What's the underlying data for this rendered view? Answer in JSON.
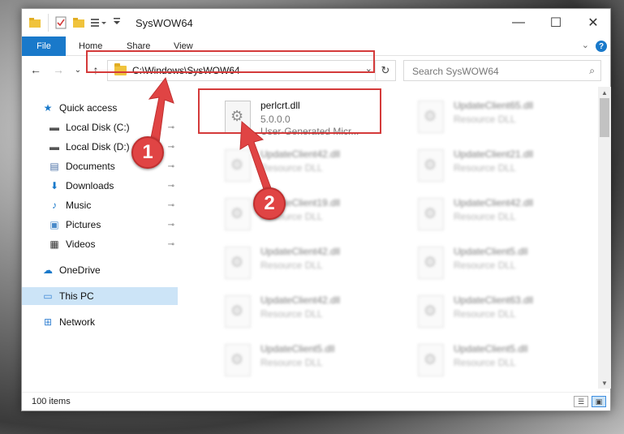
{
  "window": {
    "title": "SysWOW64",
    "minimize": "—",
    "maximize": "☐",
    "close": "✕"
  },
  "ribbon": {
    "tabs": [
      "File",
      "Home",
      "Share",
      "View"
    ],
    "help": "?",
    "collapse": "⌄"
  },
  "nav": {
    "back": "←",
    "forward": "→",
    "recent": "⌄",
    "up": "↑",
    "address": "C:\\Windows\\SysWOW64",
    "address_dropdown": "⌄",
    "refresh": "↻",
    "search_placeholder": "Search SysWOW64",
    "search_icon": "⌕"
  },
  "sidebar": {
    "items": [
      {
        "label": "Quick access",
        "icon": "star-icon",
        "glyph": "★",
        "color": "#1979ca"
      },
      {
        "label": "Local Disk (C:)",
        "icon": "drive-icon",
        "glyph": "▬",
        "color": "#555555",
        "pinned": true
      },
      {
        "label": "Local Disk (D:)",
        "icon": "drive-icon",
        "glyph": "▬",
        "color": "#555555",
        "pinned": true
      },
      {
        "label": "Documents",
        "icon": "documents-icon",
        "glyph": "▤",
        "color": "#4a6fa5",
        "pinned": true
      },
      {
        "label": "Downloads",
        "icon": "download-icon",
        "glyph": "⬇",
        "color": "#1979ca",
        "pinned": true
      },
      {
        "label": "Music",
        "icon": "music-icon",
        "glyph": "♪",
        "color": "#1979ca",
        "pinned": true
      },
      {
        "label": "Pictures",
        "icon": "pictures-icon",
        "glyph": "▣",
        "color": "#4a8ac9",
        "pinned": true
      },
      {
        "label": "Videos",
        "icon": "videos-icon",
        "glyph": "▦",
        "color": "#333333",
        "pinned": true
      },
      {
        "label": "OneDrive",
        "icon": "cloud-icon",
        "glyph": "☁",
        "color": "#1979ca"
      },
      {
        "label": "This PC",
        "icon": "computer-icon",
        "glyph": "▭",
        "color": "#3b86d4",
        "selected": true
      },
      {
        "label": "Network",
        "icon": "network-icon",
        "glyph": "⊞",
        "color": "#3b86d4"
      }
    ],
    "pin_glyph": "📌"
  },
  "files": [
    {
      "name": "perlcrt.dll",
      "meta1": "5.0.0.0",
      "meta2": "User-Generated Micr...",
      "highlighted": true
    },
    {
      "name": "UpdateClient65.dll",
      "meta1": "Resource DLL",
      "meta2": ""
    },
    {
      "name": "UpdateClient42.dll",
      "meta1": "Resource DLL",
      "meta2": ""
    },
    {
      "name": "UpdateClient21.dll",
      "meta1": "Resource DLL",
      "meta2": ""
    },
    {
      "name": "UpdateClient19.dll",
      "meta1": "Resource DLL",
      "meta2": ""
    },
    {
      "name": "UpdateClient42.dll",
      "meta1": "Resource DLL",
      "meta2": ""
    },
    {
      "name": "UpdateClient42.dll",
      "meta1": "Resource DLL",
      "meta2": ""
    },
    {
      "name": "UpdateClient5.dll",
      "meta1": "Resource DLL",
      "meta2": ""
    },
    {
      "name": "UpdateClient42.dll",
      "meta1": "Resource DLL",
      "meta2": ""
    },
    {
      "name": "UpdateClient63.dll",
      "meta1": "Resource DLL",
      "meta2": ""
    },
    {
      "name": "UpdateClient5.dll",
      "meta1": "Resource DLL",
      "meta2": ""
    },
    {
      "name": "UpdateClient5.dll",
      "meta1": "Resource DLL",
      "meta2": ""
    }
  ],
  "status": {
    "count": "100 items"
  },
  "annotations": {
    "badge1": "1",
    "badge2": "2",
    "color": "#e04444"
  }
}
